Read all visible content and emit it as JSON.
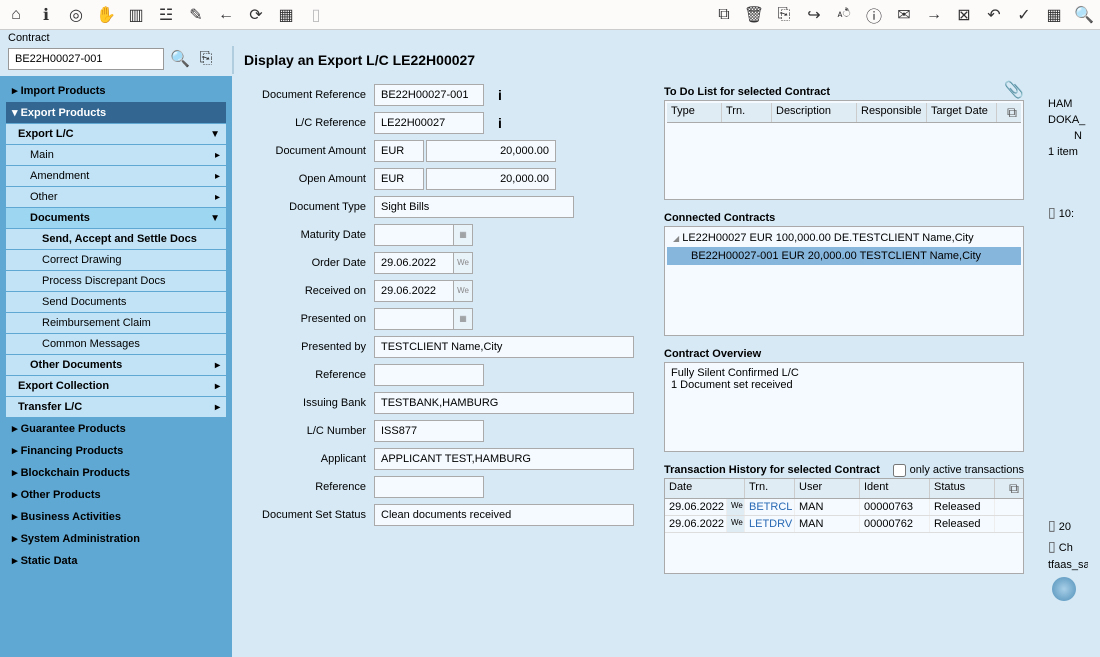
{
  "toolbar": {
    "icons_left": [
      "home",
      "info",
      "target",
      "hand",
      "book",
      "shapes",
      "edit",
      "back",
      "refresh",
      "calendar",
      "page"
    ],
    "icons_right": [
      "edit2",
      "trash",
      "newdoc",
      "forward",
      "revchars",
      "info2",
      "mail",
      "send",
      "boxx",
      "undo",
      "check",
      "cal2",
      "magnify"
    ]
  },
  "contract_label": "Contract",
  "search_value": "BE22H00027-001",
  "title": "Display an Export L/C LE22H00027",
  "nav": {
    "items": [
      {
        "label": "Import Products",
        "level": 1
      },
      {
        "label": "Export Products",
        "level": 1,
        "selected": true,
        "expanded": true
      },
      {
        "label": "Export L/C",
        "level": 2,
        "expanded": true
      },
      {
        "label": "Main",
        "level": 3
      },
      {
        "label": "Amendment",
        "level": 3
      },
      {
        "label": "Other",
        "level": 3
      },
      {
        "label": "Documents",
        "level": 3,
        "bold": true,
        "selected": true,
        "expanded": true
      },
      {
        "label": "Send, Accept and Settle Docs",
        "level": 4,
        "bold": true
      },
      {
        "label": "Correct Drawing",
        "level": 4
      },
      {
        "label": "Process Discrepant Docs",
        "level": 4
      },
      {
        "label": "Send Documents",
        "level": 4
      },
      {
        "label": "Reimbursement Claim",
        "level": 4
      },
      {
        "label": "Common Messages",
        "level": 4
      },
      {
        "label": "Other Documents",
        "level": 3,
        "bold": true
      },
      {
        "label": "Export Collection",
        "level": 2
      },
      {
        "label": "Transfer L/C",
        "level": 2
      },
      {
        "label": "Guarantee Products",
        "level": 1
      },
      {
        "label": "Financing Products",
        "level": 1
      },
      {
        "label": "Blockchain Products",
        "level": 1
      },
      {
        "label": "Other Products",
        "level": 1
      },
      {
        "label": "Business Activities",
        "level": 1
      },
      {
        "label": "System Administration",
        "level": 1
      },
      {
        "label": "Static Data",
        "level": 1
      }
    ]
  },
  "form": {
    "doc_ref": {
      "label": "Document Reference",
      "value": "BE22H00027-001"
    },
    "lc_ref": {
      "label": "L/C Reference",
      "value": "LE22H00027"
    },
    "doc_amount": {
      "label": "Document Amount",
      "currency": "EUR",
      "value": "20,000.00"
    },
    "open_amount": {
      "label": "Open Amount",
      "currency": "EUR",
      "value": "20,000.00"
    },
    "doc_type": {
      "label": "Document Type",
      "value": "Sight Bills"
    },
    "maturity": {
      "label": "Maturity Date",
      "value": ""
    },
    "order_date": {
      "label": "Order Date",
      "value": "29.06.2022",
      "day": "We"
    },
    "received": {
      "label": "Received on",
      "value": "29.06.2022",
      "day": "We"
    },
    "presented_on": {
      "label": "Presented on",
      "value": ""
    },
    "presented_by": {
      "label": "Presented by",
      "value": "TESTCLIENT Name,City"
    },
    "reference1": {
      "label": "Reference",
      "value": ""
    },
    "issuing_bank": {
      "label": "Issuing Bank",
      "value": "TESTBANK,HAMBURG"
    },
    "lc_number": {
      "label": "L/C Number",
      "value": "ISS877"
    },
    "applicant": {
      "label": "Applicant",
      "value": "APPLICANT TEST,HAMBURG"
    },
    "reference2": {
      "label": "Reference",
      "value": ""
    },
    "doc_set_status": {
      "label": "Document Set Status",
      "value": "Clean documents received"
    }
  },
  "todo": {
    "title": "To Do List for selected Contract",
    "cols": {
      "type": "Type",
      "trn": "Trn.",
      "desc": "Description",
      "resp": "Responsible",
      "target": "Target Date"
    }
  },
  "connected": {
    "title": "Connected Contracts",
    "parent": "LE22H00027 EUR 100,000.00 DE.TESTCLIENT Name,City",
    "child": "BE22H00027-001 EUR 20,000.00 TESTCLIENT Name,City"
  },
  "overview": {
    "title": "Contract Overview",
    "line1": "Fully Silent Confirmed L/C",
    "line2": "1 Document set received"
  },
  "trans": {
    "title": "Transaction History for selected Contract",
    "only_active_label": "only active transactions",
    "cols": {
      "date": "Date",
      "trn": "Trn.",
      "user": "User",
      "ident": "Ident",
      "status": "Status"
    },
    "rows": [
      {
        "date": "29.06.2022",
        "day": "We",
        "trn": "BETRCL",
        "user": "MAN",
        "ident": "00000763",
        "status": "Released"
      },
      {
        "date": "29.06.2022",
        "day": "We",
        "trn": "LETDRV",
        "user": "MAN",
        "ident": "00000762",
        "status": "Released"
      }
    ]
  },
  "ext": {
    "r1": "HAM",
    "r2": "DOKA_",
    "r3": "N",
    "r4": "1 item",
    "r5": "10:",
    "r6": "20",
    "r7": "Ch",
    "r8": "tfaas_sa"
  }
}
